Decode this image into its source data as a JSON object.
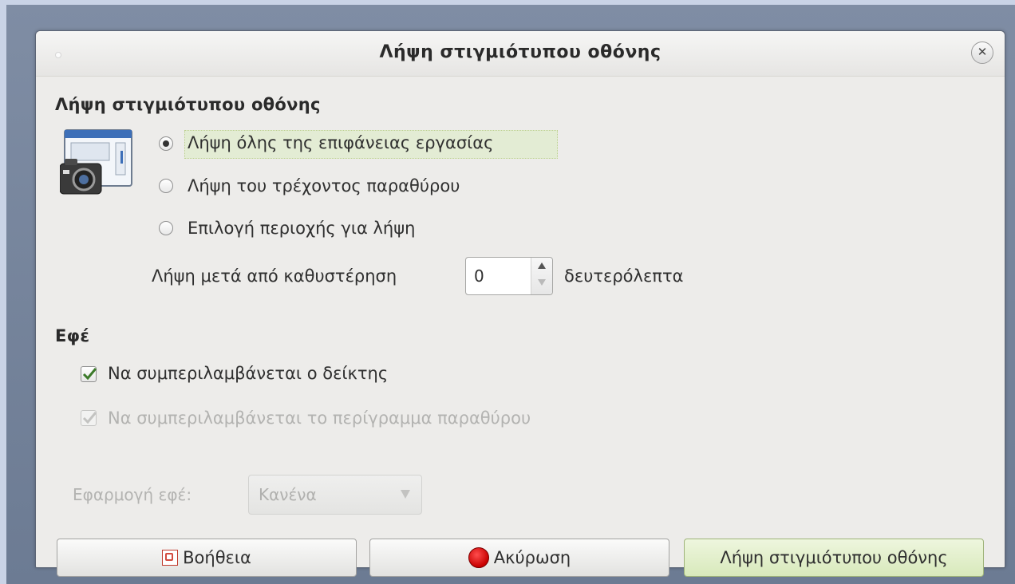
{
  "window": {
    "title": "Λήψη στιγμιότυπου οθόνης"
  },
  "capture": {
    "heading": "Λήψη στιγμιότυπου οθόνης",
    "options": [
      {
        "label": "Λήψη όλης της επιφάνειας εργασίας",
        "selected": true
      },
      {
        "label": "Λήψη του τρέχοντος παραθύρου",
        "selected": false
      },
      {
        "label": "Επιλογή περιοχής για λήψη",
        "selected": false
      }
    ],
    "delay_label": "Λήψη μετά από καθυστέρηση",
    "delay_value": "0",
    "delay_unit": "δευτερόλεπτα"
  },
  "effects": {
    "heading": "Εφέ",
    "include_pointer": {
      "label": "Να συμπεριλαμβάνεται ο δείκτης",
      "checked": true
    },
    "include_border": {
      "label": "Να συμπεριλαμβάνεται το περίγραμμα παραθύρου",
      "checked": true,
      "disabled": true
    },
    "apply_label": "Εφαρμογή εφέ:",
    "apply_value": "Κανένα"
  },
  "buttons": {
    "help": "Βοήθεια",
    "cancel": "Ακύρωση",
    "take": "Λήψη στιγμιότυπου οθόνης"
  },
  "colors": {
    "default_button": "#d8e9bb",
    "focus_highlight": "#e3ecd4"
  }
}
